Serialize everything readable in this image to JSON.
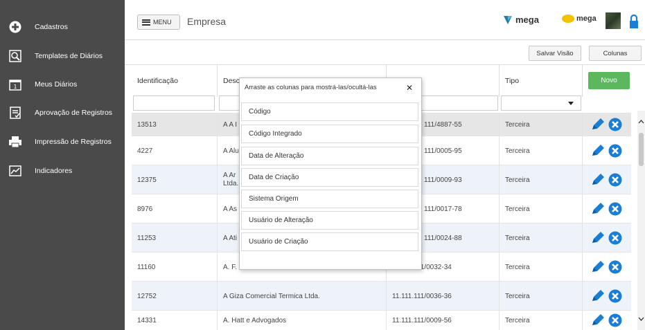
{
  "sidebar": {
    "items": [
      {
        "label": "Cadastros",
        "icon": "plus-circle-icon"
      },
      {
        "label": "Templates de Diários",
        "icon": "search-document-icon"
      },
      {
        "label": "Meus Diários",
        "icon": "calendar-icon"
      },
      {
        "label": "Aprovação de Registros",
        "icon": "checklist-icon"
      },
      {
        "label": "Impressão de Registros",
        "icon": "printer-icon"
      },
      {
        "label": "Indicadores",
        "icon": "chart-icon"
      }
    ]
  },
  "header": {
    "menu_label": "MENU",
    "title": "Empresa",
    "logo1": "mega",
    "logo2": "mega"
  },
  "toolbar": {
    "save_view": "Salvar Visão",
    "columns": "Colunas",
    "new": "Novo"
  },
  "table": {
    "headers": {
      "id": "Identificação",
      "desc": "Desc",
      "tipo": "Tipo"
    },
    "rows": [
      {
        "id": "13513",
        "desc": "A A I",
        "cnpj": "111/4887-55",
        "tipo": "Terceira"
      },
      {
        "id": "4227",
        "desc": "A Alu",
        "cnpj": "111/0005-95",
        "tipo": "Terceira"
      },
      {
        "id": "12375",
        "desc": "A Ar",
        "desc2": "Ltda.",
        "cnpj": "111/0009-93",
        "tipo": "Terceira"
      },
      {
        "id": "8976",
        "desc": "A As",
        "cnpj": "111/0017-78",
        "tipo": "Terceira"
      },
      {
        "id": "11253",
        "desc": "A Ati",
        "cnpj": "111/0024-88",
        "tipo": "Terceira"
      },
      {
        "id": "11160",
        "desc": "A. F. Perossi Plasticos EPP",
        "cnpj": "11.111.111/0032-34",
        "tipo": "Terceira"
      },
      {
        "id": "12752",
        "desc": "A Giza Comercial Termica Ltda.",
        "cnpj": "11.111.111/0036-36",
        "tipo": "Terceira"
      },
      {
        "id": "14331",
        "desc": "A. Hatt e Advogados",
        "cnpj": "11.111.111/0009-56",
        "tipo": "Terceira"
      }
    ]
  },
  "popup": {
    "title": "Arraste as colunas para mostrá-las/ocultá-las",
    "close": "✕",
    "items": [
      "Código",
      "Código Integrado",
      "Data de Alteração",
      "Data de Criação",
      "Sistema Origem",
      "Usuário de Alteração",
      "Usuário de Criação"
    ]
  },
  "colors": {
    "sidebar_bg": "#4a4a4a",
    "novo_green": "#5cb85c",
    "edit_blue": "#1a7fd4",
    "delete_blue": "#1a7fd4"
  }
}
